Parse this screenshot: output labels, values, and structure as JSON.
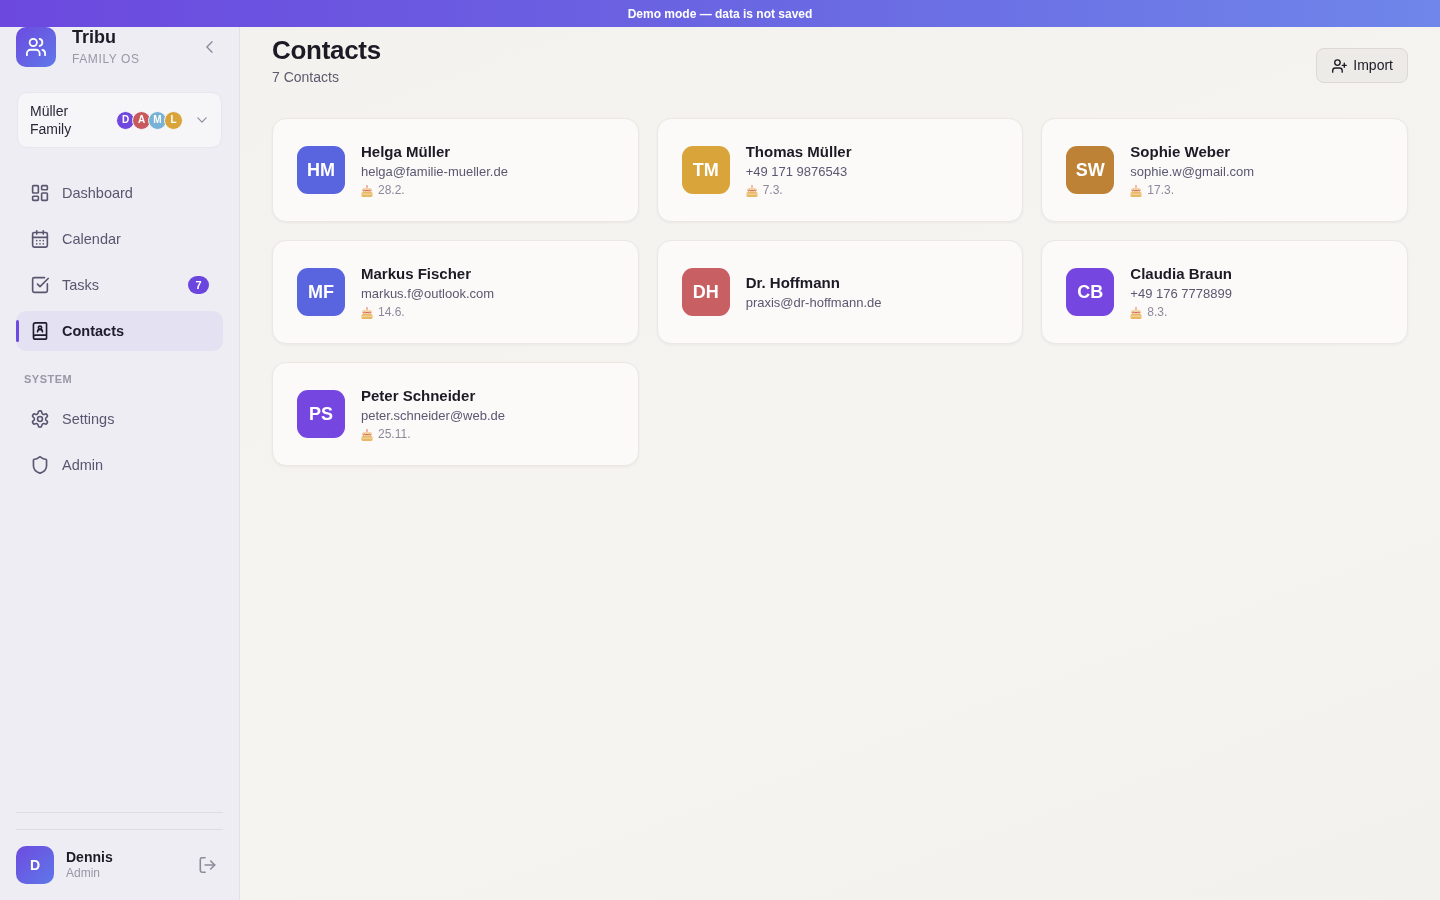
{
  "banner": {
    "text": "Demo mode — data is not saved"
  },
  "sidebar": {
    "brand": {
      "name": "Tribu",
      "tagline": "FAMILY OS"
    },
    "family": {
      "name": "Müller Family",
      "members": [
        {
          "initial": "D",
          "color": "#7048e0"
        },
        {
          "initial": "A",
          "color": "#c85a5e"
        },
        {
          "initial": "M",
          "color": "#78b2d6"
        },
        {
          "initial": "L",
          "color": "#d9a43a"
        }
      ]
    },
    "sections": [
      {
        "items": [
          {
            "label": "Dashboard",
            "selected": false
          },
          {
            "label": "Calendar",
            "selected": false
          },
          {
            "label": "Tasks",
            "selected": false,
            "badge": "7"
          },
          {
            "label": "Contacts",
            "selected": true
          }
        ]
      },
      {
        "title": "SYSTEM",
        "items": [
          {
            "label": "Settings",
            "selected": false
          },
          {
            "label": "Admin",
            "selected": false
          }
        ]
      }
    ],
    "user": {
      "initial": "D",
      "name": "Dennis",
      "role": "Admin"
    }
  },
  "page": {
    "title": "Contacts",
    "subtitle": "7 Contacts",
    "action": "Import"
  },
  "contacts": [
    {
      "initials": "HM",
      "name": "Helga Müller",
      "detail": "helga@familie-mueller.de",
      "birthday": "28.2.",
      "color": "#5865df"
    },
    {
      "initials": "TM",
      "name": "Thomas Müller",
      "detail": "+49 171 9876543",
      "birthday": "7.3.",
      "color": "#d9a43a"
    },
    {
      "initials": "SW",
      "name": "Sophie Weber",
      "detail": "sophie.w@gmail.com",
      "birthday": "17.3.",
      "color": "#bd8235"
    },
    {
      "initials": "MF",
      "name": "Markus Fischer",
      "detail": "markus.f@outlook.com",
      "birthday": "14.6.",
      "color": "#5865df"
    },
    {
      "initials": "DH",
      "name": "Dr. Hoffmann",
      "detail": "praxis@dr-hoffmann.de",
      "color": "#c85f62"
    },
    {
      "initials": "CB",
      "name": "Claudia Braun",
      "detail": "+49 176 7778899",
      "birthday": "8.3.",
      "color": "#7646e0"
    },
    {
      "initials": "PS",
      "name": "Peter Schneider",
      "detail": "peter.schneider@web.de",
      "birthday": "25.11.",
      "color": "#7646e0"
    }
  ]
}
